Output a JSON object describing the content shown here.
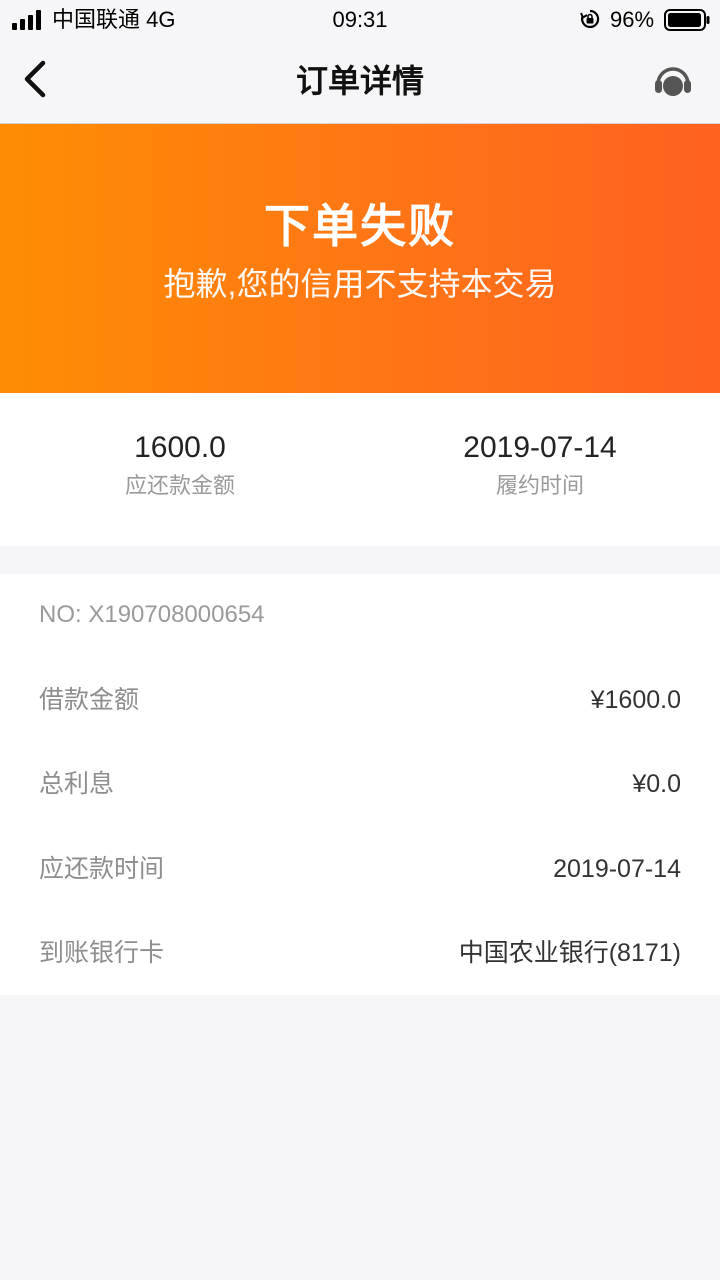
{
  "status_bar": {
    "carrier": "中国联通 4G",
    "time": "09:31",
    "battery": "96%"
  },
  "nav": {
    "title": "订单详情"
  },
  "banner": {
    "title": "下单失败",
    "subtitle": "抱歉,您的信用不支持本交易"
  },
  "summary": {
    "amount_value": "1600.0",
    "amount_label": "应还款金额",
    "date_value": "2019-07-14",
    "date_label": "履约时间"
  },
  "details": {
    "order_no": "NO: X190708000654",
    "rows": [
      {
        "label": "借款金额",
        "value": "¥1600.0"
      },
      {
        "label": "总利息",
        "value": "¥0.0"
      },
      {
        "label": "应还款时间",
        "value": "2019-07-14"
      },
      {
        "label": "到账银行卡",
        "value": "中国农业银行(8171)"
      }
    ]
  },
  "colors": {
    "banner_start": "#fe8d03",
    "banner_end": "#ff611f",
    "page_background": "#f6f6f8"
  },
  "icons": {
    "back": "chevron-left-icon",
    "support": "headset-icon"
  }
}
